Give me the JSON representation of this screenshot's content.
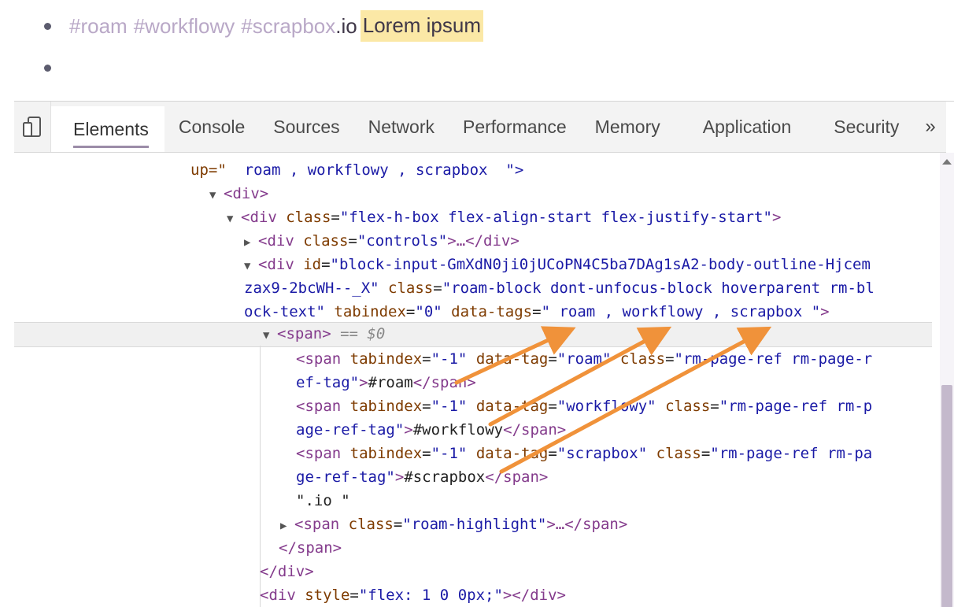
{
  "roam": {
    "bullet1": {
      "tag_roam": "#roam",
      "tag_workflowy": "#workflowy",
      "tag_scrapbox": "#scrapbox",
      "io": ".io",
      "highlight": "Lorem ipsum"
    }
  },
  "devtools": {
    "tabs": [
      "Elements",
      "Console",
      "Sources",
      "Network",
      "Performance",
      "Memory",
      "Application",
      "Security"
    ],
    "active_tab": "Elements",
    "more_label": "»",
    "code": {
      "l1_prefix": "up=\"",
      "l1_value": "  roam , workflowy , scrapbox  \">",
      "l2_div": "<div>",
      "l3_open": "<div ",
      "l3_attr": "class",
      "l3_val": "\"flex-h-box flex-align-start flex-justify-start\"",
      "l3_close": ">",
      "l4_open": "<div ",
      "l4_attr": "class",
      "l4_val": "\"controls\"",
      "l4_close": ">…</div>",
      "l5_open": "<div ",
      "l5_attr": "id",
      "l5_val": "\"block-input-GmXdN0ji0jUCoPN4C5ba7DAg1sA2-body-outline-Hjcem",
      "l6_val": "zax9-2bcWH--_X\"",
      "l6_attr": "class",
      "l6_val2": "\"roam-block dont-unfocus-block hoverparent rm-bl",
      "l7_val": "ock-text\"",
      "l7_attr": "tabindex",
      "l7_val2": "\"0\"",
      "l7_attr2": "data-tags",
      "l7_val3": "\" roam , workflowy , scrapbox \"",
      "l7_close": ">",
      "l8_tag": "<span>",
      "l8_eq": " == $0",
      "s1a": "<span ",
      "s1b": "tabindex",
      "s1c": "\"-1\"",
      "s1d": "data-tag",
      "s1e": "\"roam\"",
      "s1f": "class",
      "s1g": "\"rm-page-ref rm-page-r",
      "s1h": "ef-tag\"",
      "s1i": ">",
      "s1j": "#roam",
      "s1k": "</span>",
      "s2e": "\"workflowy\"",
      "s2g": "\"rm-page-ref rm-p",
      "s2h": "age-ref-tag\"",
      "s2j": "#workflowy",
      "s3e": "\"scrapbox\"",
      "s3g": "\"rm-page-ref rm-pa",
      "s3h": "ge-ref-tag\"",
      "s3j": "#scrapbox",
      "io": "\".io \"",
      "hl_open": "<span ",
      "hl_attr": "class",
      "hl_val": "\"roam-highlight\"",
      "hl_close": ">…</span>",
      "close_span": "</span>",
      "close_div": "</div>",
      "last_open": "<div ",
      "last_attr": "style",
      "last_val": "\"flex: 1 0 0px;\"",
      "last_close": "></div>"
    }
  },
  "colors": {
    "arrow": "#f0923a",
    "tag_text": "#b9a8c7",
    "highlight_bg": "#fbe8a6"
  }
}
